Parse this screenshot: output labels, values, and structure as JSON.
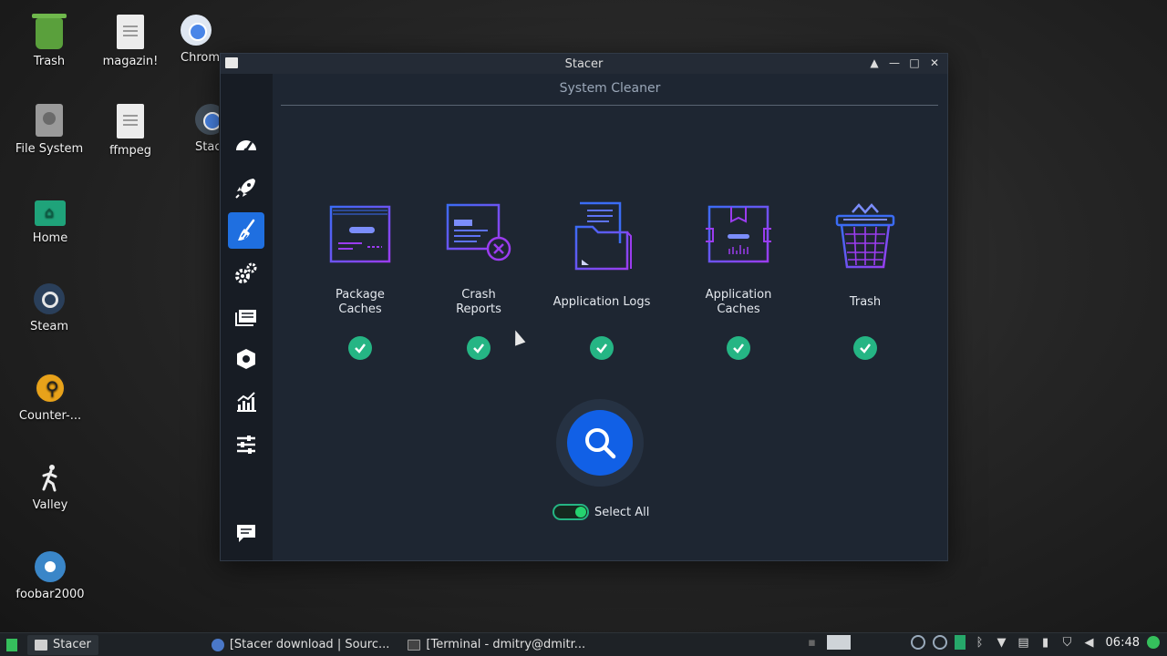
{
  "desktop": {
    "icons": [
      {
        "label": "Trash"
      },
      {
        "label": "magazin!"
      },
      {
        "label": "Chrom"
      },
      {
        "label": "File System"
      },
      {
        "label": "ffmpeg"
      },
      {
        "label": "Stac"
      },
      {
        "label": "Home"
      },
      {
        "label": "Steam"
      },
      {
        "label": "Counter-..."
      },
      {
        "label": "Valley"
      },
      {
        "label": "foobar2000"
      }
    ]
  },
  "window": {
    "title": "Stacer",
    "controls": [
      "▲",
      "—",
      "□",
      "✕"
    ]
  },
  "sidebar": {
    "items": [
      {
        "icon": "dashboard-icon"
      },
      {
        "icon": "startup-rocket-icon"
      },
      {
        "icon": "system-cleaner-broom-icon",
        "active": true
      },
      {
        "icon": "services-gears-icon"
      },
      {
        "icon": "uninstaller-icon"
      },
      {
        "icon": "resources-icon"
      },
      {
        "icon": "charts-icon"
      },
      {
        "icon": "settings-sliders-icon"
      },
      {
        "icon": "feedback-icon"
      }
    ]
  },
  "cleaner": {
    "title": "System Cleaner",
    "categories": [
      {
        "label": "Package Caches",
        "icon": "package-caches-icon",
        "checked": true
      },
      {
        "label": "Crash Reports",
        "icon": "crash-reports-icon",
        "checked": true
      },
      {
        "label": "Application Logs",
        "icon": "application-logs-icon",
        "checked": true
      },
      {
        "label": "Application Caches",
        "icon": "application-caches-icon",
        "checked": true
      },
      {
        "label": "Trash",
        "icon": "trash-icon",
        "checked": true
      }
    ],
    "select_all_label": "Select All",
    "select_all_on": true
  },
  "taskbar": {
    "tasks": [
      {
        "label": "Stacer",
        "active": true
      },
      {
        "label": "[Stacer download | Sourc..."
      },
      {
        "label": "[Terminal - dmitry@dmitr..."
      }
    ],
    "clock": "06:48"
  },
  "colors": {
    "accent": "#1160e6",
    "check": "#25b584",
    "window_bg": "#1e2632",
    "sidebar_bg": "#171c24",
    "icon_purple": "#9b3cf0",
    "icon_blue": "#3b6cf5"
  }
}
